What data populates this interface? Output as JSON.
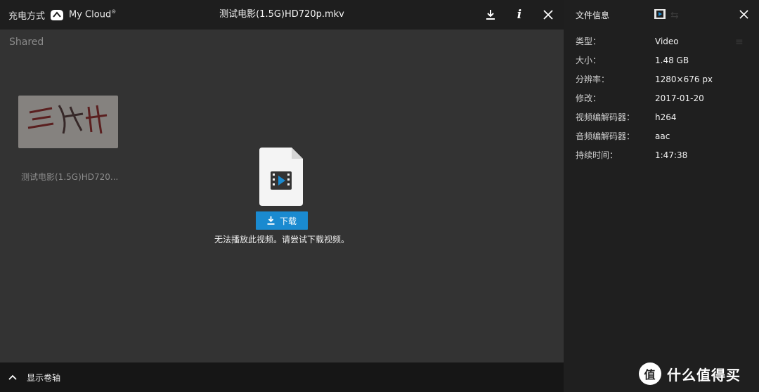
{
  "brand": {
    "prefix": "充电方式",
    "product": "My Cloud",
    "reg": "®"
  },
  "viewer": {
    "title": "测试电影(1.5G)HD720p.mkv",
    "download_label": "下载",
    "message": "无法播放此视频。请尝试下载视频。"
  },
  "background": {
    "section": "Shared",
    "thumbnail_label": "测试电影(1.5G)HD720..."
  },
  "bottombar": {
    "label": "显示卷轴"
  },
  "info_panel": {
    "title": "文件信息",
    "rows": [
      {
        "key": "类型：",
        "value": "Video"
      },
      {
        "key": "大小：",
        "value": "1.48 GB"
      },
      {
        "key": "分辨率：",
        "value": "1280×676 px"
      },
      {
        "key": "修改：",
        "value": "2017-01-20"
      },
      {
        "key": "视频编解码器：",
        "value": "h264"
      },
      {
        "key": "音频编解码器：",
        "value": "aac"
      },
      {
        "key": "持续时间：",
        "value": "1:47:38"
      }
    ]
  },
  "watermark": {
    "glyph": "值",
    "text": "什么值得买"
  },
  "icons": {
    "download": "download-icon",
    "info": "info-icon",
    "close": "close-icon",
    "chevron": "chevron-up-icon",
    "file_video": "video-file-icon",
    "cloud": "cloud-logo-icon"
  },
  "colors": {
    "accent": "#1a8ad0",
    "topbar": "#1e1e1e",
    "panel": "#1f1f1f",
    "stage": "#333333"
  }
}
